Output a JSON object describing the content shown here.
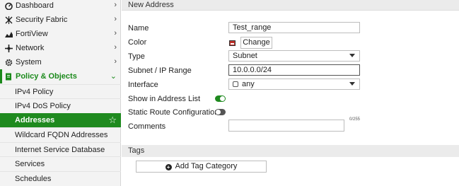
{
  "sidebar": {
    "items": [
      {
        "label": "Dashboard",
        "icon": "dashboard-icon",
        "chevron": "›"
      },
      {
        "label": "Security Fabric",
        "icon": "security-fabric-icon",
        "chevron": "›"
      },
      {
        "label": "FortiView",
        "icon": "fortiview-icon",
        "chevron": "›"
      },
      {
        "label": "Network",
        "icon": "network-icon",
        "chevron": "›"
      },
      {
        "label": "System",
        "icon": "system-icon",
        "chevron": "›"
      },
      {
        "label": "Policy & Objects",
        "icon": "policy-objects-icon",
        "chevron": "⌄"
      }
    ],
    "subitems": [
      {
        "label": "IPv4 Policy"
      },
      {
        "label": "IPv4 DoS Policy"
      },
      {
        "label": "Addresses"
      },
      {
        "label": "Wildcard FQDN Addresses"
      },
      {
        "label": "Internet Service Database"
      },
      {
        "label": "Services"
      },
      {
        "label": "Schedules"
      }
    ],
    "active_star": "☆"
  },
  "main": {
    "header": "New Address",
    "fields": {
      "name_label": "Name",
      "name_value": "Test_range",
      "color_label": "Color",
      "color_button": "Change",
      "type_label": "Type",
      "type_value": "Subnet",
      "subnet_label": "Subnet / IP Range",
      "subnet_value": "10.0.0.0/24",
      "interface_label": "Interface",
      "interface_value": "any",
      "show_list_label": "Show in Address List",
      "static_route_label": "Static Route Configuration",
      "comments_label": "Comments",
      "comments_counter": "0/255"
    },
    "toggles": {
      "show_in_address_list": true,
      "static_route_configuration": false
    },
    "tags": {
      "section_label": "Tags",
      "add_button": "Add Tag Category"
    }
  },
  "colors": {
    "accent": "#1f8a1f",
    "swatch": "#c0322a"
  }
}
